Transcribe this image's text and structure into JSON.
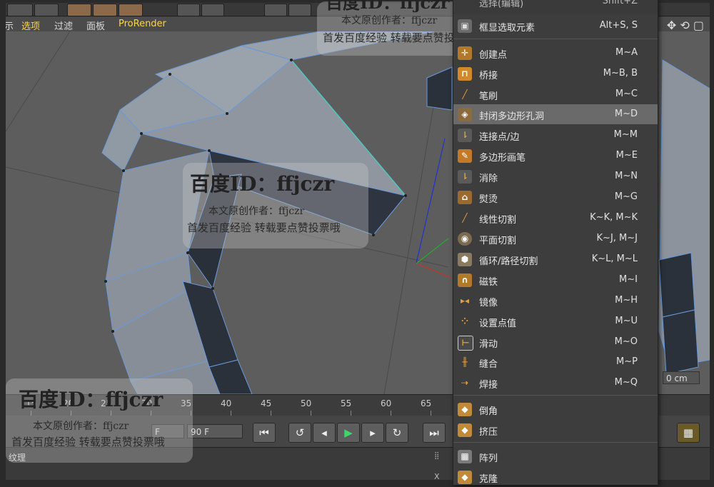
{
  "viewport_menu": [
    "示",
    "选项",
    "过滤",
    "面板",
    "ProRender"
  ],
  "menu": {
    "top_partial": {
      "label": "选择(编辑)",
      "shortcut": "Shift+Z"
    },
    "items": [
      {
        "label": "框显选取元素",
        "shortcut": "Alt+S, S",
        "icon": "frame-select-icon"
      },
      {
        "label": "创建点",
        "shortcut": "M~A",
        "icon": "create-point-icon"
      },
      {
        "label": "桥接",
        "shortcut": "M~B, B",
        "icon": "bridge-icon"
      },
      {
        "label": "笔刷",
        "shortcut": "M~C",
        "icon": "brush-icon"
      },
      {
        "label": "封闭多边形孔洞",
        "shortcut": "M~D",
        "icon": "close-polygon-hole-icon",
        "highlighted": true
      },
      {
        "label": "连接点/边",
        "shortcut": "M~M",
        "icon": "connect-points-edges-icon"
      },
      {
        "label": "多边形画笔",
        "shortcut": "M~E",
        "icon": "polygon-pen-icon"
      },
      {
        "label": "消除",
        "shortcut": "M~N",
        "icon": "dissolve-icon"
      },
      {
        "label": "熨烫",
        "shortcut": "M~G",
        "icon": "iron-icon"
      },
      {
        "label": "线性切割",
        "shortcut": "K~K, M~K",
        "icon": "line-cut-icon"
      },
      {
        "label": "平面切割",
        "shortcut": "K~J, M~J",
        "icon": "plane-cut-icon"
      },
      {
        "label": "循环/路径切割",
        "shortcut": "K~L, M~L",
        "icon": "loop-path-cut-icon"
      },
      {
        "label": "磁铁",
        "shortcut": "M~I",
        "icon": "magnet-icon"
      },
      {
        "label": "镜像",
        "shortcut": "M~H",
        "icon": "mirror-icon"
      },
      {
        "label": "设置点值",
        "shortcut": "M~U",
        "icon": "set-point-value-icon"
      },
      {
        "label": "滑动",
        "shortcut": "M~O",
        "icon": "slide-icon"
      },
      {
        "label": "缝合",
        "shortcut": "M~P",
        "icon": "stitch-icon"
      },
      {
        "label": "焊接",
        "shortcut": "M~Q",
        "icon": "weld-icon"
      }
    ],
    "items2": [
      {
        "label": "倒角",
        "shortcut": "",
        "icon": "bevel-icon"
      },
      {
        "label": "挤压",
        "shortcut": "",
        "icon": "extrude-icon"
      }
    ],
    "items3": [
      {
        "label": "阵列",
        "shortcut": "",
        "icon": "array-icon"
      },
      {
        "label": "克隆",
        "shortcut": "",
        "icon": "clone-icon"
      }
    ]
  },
  "timeline": {
    "ticks": [
      "15",
      "20",
      "25",
      "30",
      "35",
      "40",
      "45",
      "50",
      "55",
      "60",
      "65"
    ]
  },
  "playbar": {
    "start_field": "F",
    "end_field": "90 F"
  },
  "bottom": {
    "texture_label": "纹理",
    "corner": "X"
  },
  "viewport": {
    "distance_readout": "0 cm"
  },
  "watermark": {
    "title": "百度ID：ffjczr",
    "author": "本文原创作者：ffjczr",
    "notice": "首发百度经验 转载要点赞投票哦",
    "top_title": "百度ID：ffjczr",
    "top_author": "本文原创作者：ffjczr",
    "top_notice": "首发百度经验 转载要点赞投票哦"
  }
}
